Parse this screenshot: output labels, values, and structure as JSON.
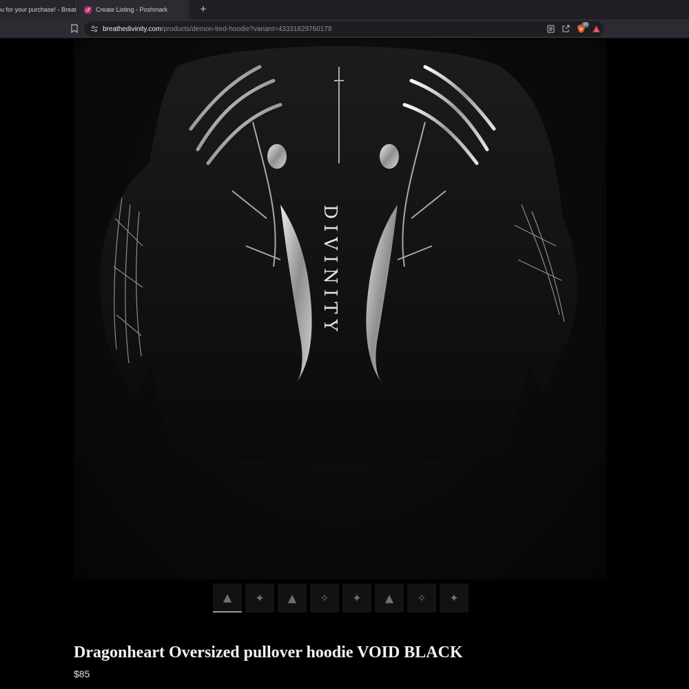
{
  "browser": {
    "tabs": [
      {
        "label": "ou for your purchase! - Breat"
      },
      {
        "label": "Create Listing - Poshmark"
      }
    ],
    "new_tab_label": "+",
    "url_host": "breathedivinity.com",
    "url_path": "/products/demon-lord-hoodie?variant=43331829760178",
    "brave_count": "10"
  },
  "product": {
    "title": "Dragonheart Oversized pullover hoodie VOID BLACK",
    "price": "$85",
    "print_text": "DIVINITY",
    "thumbnail_count": 8
  },
  "icons": {
    "tab_favicon": "poshmark-icon",
    "bookmark": "bookmark-icon",
    "site_info": "tune-icon",
    "reader": "reader-mode-icon",
    "share": "share-icon",
    "brave": "brave-shield-icon",
    "rewards": "brave-rewards-icon"
  }
}
